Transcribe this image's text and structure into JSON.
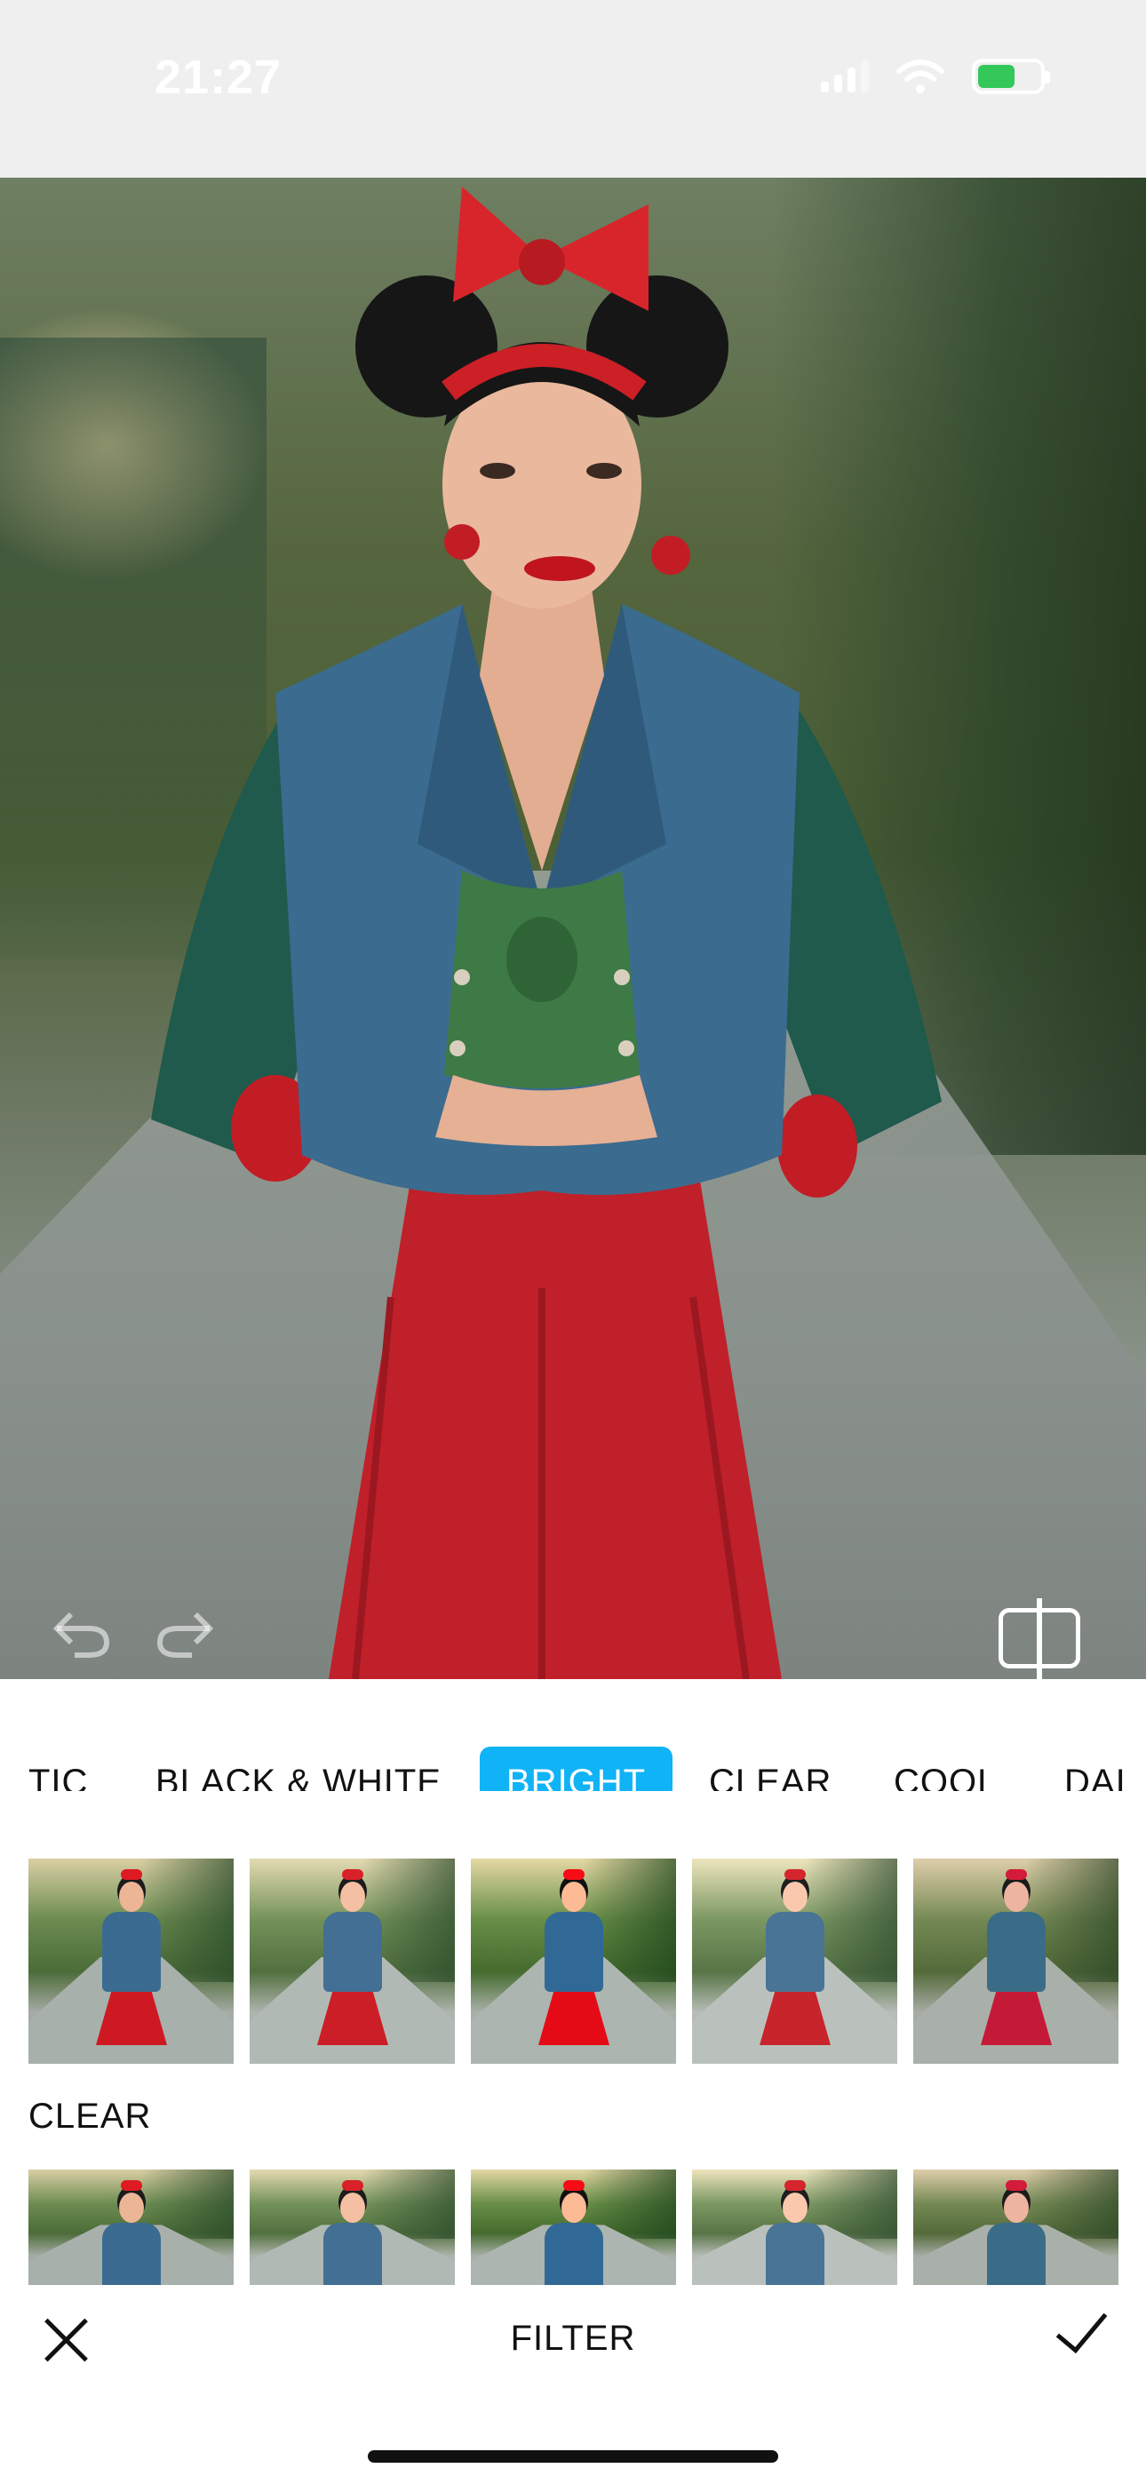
{
  "status_bar": {
    "time": "21:27",
    "battery_color": "#34c759"
  },
  "photo": {
    "undo_icon": "undo-icon",
    "redo_icon": "redo-icon",
    "compare_icon": "compare-icon"
  },
  "filters": {
    "tabs": [
      {
        "label": "TIC"
      },
      {
        "label": "BLACK & WHITE"
      },
      {
        "label": "BRIGHT"
      },
      {
        "label": "CLEAR"
      },
      {
        "label": "COOL"
      },
      {
        "label": "DAI"
      }
    ],
    "active_tab": "BRIGHT",
    "active_color": "#10b3f5"
  },
  "section": {
    "label": "CLEAR"
  },
  "bottom_bar": {
    "title": "FILTER",
    "close_icon": "close-icon",
    "confirm_icon": "checkmark-icon"
  }
}
